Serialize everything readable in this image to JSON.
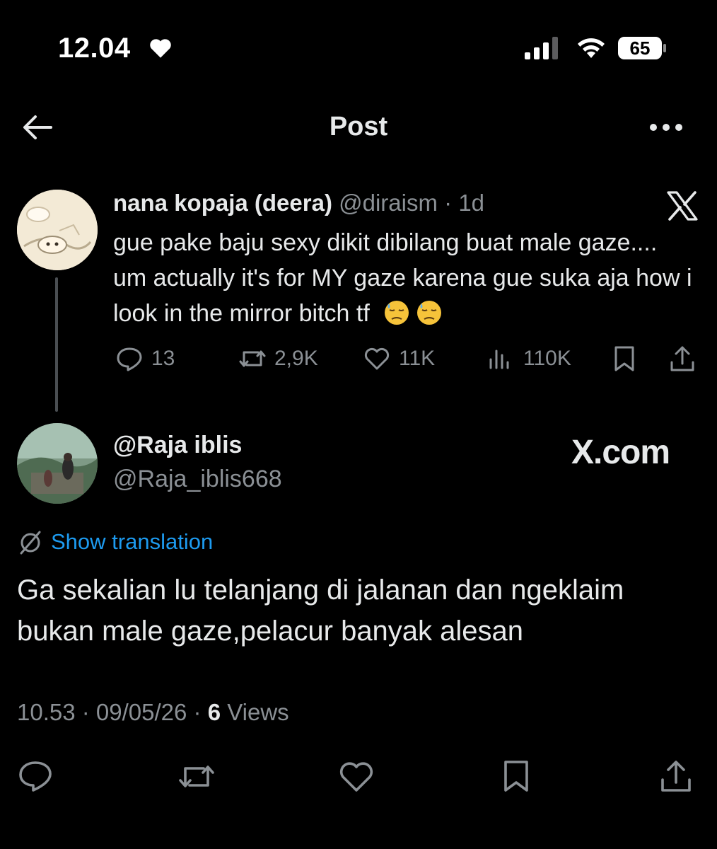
{
  "status_bar": {
    "time": "12.04",
    "battery": "65"
  },
  "header": {
    "title": "Post"
  },
  "tweet1": {
    "display_name": "nana kopaja (deera)",
    "handle": "@diraism",
    "time": "1d",
    "text": "gue pake baju sexy dikit dibilang buat male gaze.... um actually it's for MY gaze karena gue suka aja how i look in the mirror bitch tf",
    "emoji": "downcast-face-with-sweat",
    "replies": "13",
    "reposts": "2,9K",
    "likes": "11K",
    "views": "110K"
  },
  "tweet2": {
    "display_name": "@Raja iblis",
    "handle": "@Raja_iblis668",
    "watermark": "X.com",
    "show_translation": "Show translation",
    "text": "Ga sekalian lu telanjang di jalanan dan ngeklaim bukan male gaze,pelacur banyak alesan",
    "time": "10.53",
    "date": "09/05/26",
    "views_count": "6",
    "views_label": "Views"
  },
  "colors": {
    "background": "#000000",
    "text": "#e7e9ea",
    "muted": "#8b9095",
    "accent": "#1d9bf0"
  }
}
